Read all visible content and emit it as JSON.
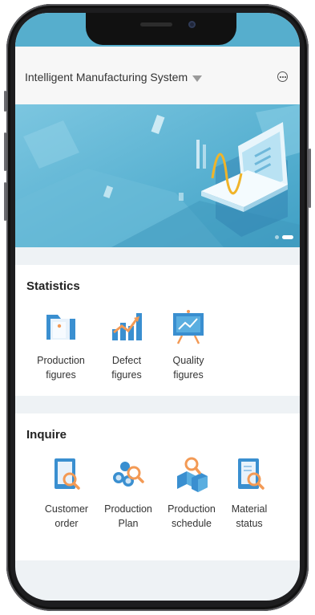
{
  "header": {
    "title": "Intelligent Manufacturing System"
  },
  "banner": {
    "slide_count": 2,
    "active_slide": 2
  },
  "statistics": {
    "title": "Statistics",
    "items": [
      {
        "line1": "Production",
        "line2": "figures",
        "icon": "production-figures-icon"
      },
      {
        "line1": "Defect",
        "line2": "figures",
        "icon": "defect-figures-icon"
      },
      {
        "line1": "Quality",
        "line2": "figures",
        "icon": "quality-figures-icon"
      }
    ]
  },
  "inquire": {
    "title": "Inquire",
    "items": [
      {
        "line1": "Customer",
        "line2": "order",
        "icon": "customer-order-icon"
      },
      {
        "line1": "Production",
        "line2": "Plan",
        "icon": "production-plan-icon"
      },
      {
        "line1": "Production",
        "line2": "schedule",
        "icon": "production-schedule-icon"
      },
      {
        "line1": "Material",
        "line2": "status",
        "icon": "material-status-icon"
      }
    ]
  },
  "colors": {
    "primary_blue": "#3a8fd0",
    "accent_orange": "#f39a55",
    "banner_blue": "#56aecd"
  }
}
